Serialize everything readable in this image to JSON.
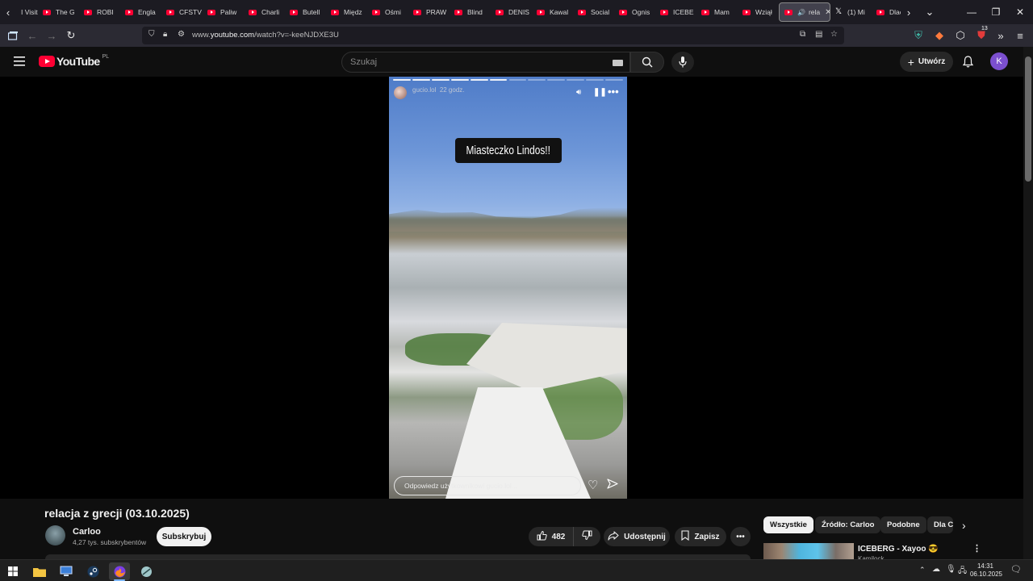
{
  "browser": {
    "tabs": [
      {
        "label": "I Visit",
        "favicon": "none"
      },
      {
        "label": "The G",
        "favicon": "youtube-icon"
      },
      {
        "label": "ROBI",
        "favicon": "youtube-icon"
      },
      {
        "label": "Engla",
        "favicon": "youtube-icon"
      },
      {
        "label": "CFSTV",
        "favicon": "youtube-icon"
      },
      {
        "label": "Paliw",
        "favicon": "youtube-icon"
      },
      {
        "label": "Charli",
        "favicon": "youtube-icon"
      },
      {
        "label": "Butell",
        "favicon": "youtube-icon"
      },
      {
        "label": "Międz",
        "favicon": "youtube-icon"
      },
      {
        "label": "Ośmi",
        "favicon": "youtube-icon"
      },
      {
        "label": "PRAW",
        "favicon": "youtube-icon"
      },
      {
        "label": "Blind",
        "favicon": "youtube-icon"
      },
      {
        "label": "DENIS",
        "favicon": "youtube-icon"
      },
      {
        "label": "Kawal",
        "favicon": "youtube-icon"
      },
      {
        "label": "Social",
        "favicon": "youtube-icon"
      },
      {
        "label": "Ognis",
        "favicon": "youtube-icon"
      },
      {
        "label": "ICEBE",
        "favicon": "youtube-icon"
      },
      {
        "label": "Mam",
        "favicon": "youtube-icon"
      },
      {
        "label": "Wziął",
        "favicon": "youtube-icon"
      }
    ],
    "active_tab": {
      "label": "rela",
      "favicon": "youtube-icon"
    },
    "extra_tabs": [
      {
        "label": "(1) Mi",
        "favicon": "x-icon"
      },
      {
        "label": "Dlac",
        "favicon": "youtube-icon"
      }
    ],
    "url_prefix": "www.",
    "url_domain": "youtube.com",
    "url_path": "/watch?v=-keeNJDXE3U",
    "extension_badge": "13"
  },
  "youtube": {
    "logo_text": "YouTube",
    "country_code": "PL",
    "search_placeholder": "Szukaj",
    "create_label": "Utwórz",
    "avatar_letter": "K",
    "accent": "#ff0033"
  },
  "story": {
    "username": "gucio.lol",
    "time_ago": "22 godz.",
    "caption": "Miasteczko Lindos!!",
    "reply_placeholder": "Odpowiedz użytkownikowi gucio.lol...",
    "segments_total": 12,
    "segments_done": 6
  },
  "video": {
    "title": "relacja z grecji (03.10.2025)",
    "channel": "Carloo",
    "subscribers": "4,27 tys. subskrybentów",
    "subscribe_label": "Subskrybuj",
    "likes": "482",
    "share_label": "Udostępnij",
    "save_label": "Zapisz"
  },
  "related": {
    "chips": [
      "Wszystkie",
      "Źródło: Carloo",
      "Podobne",
      "Dla C"
    ],
    "first_title": "ICEBERG - Xayoo 😎",
    "first_channel": "Kamilock"
  },
  "taskbar": {
    "time": "14:31",
    "date": "06.10.2025"
  }
}
